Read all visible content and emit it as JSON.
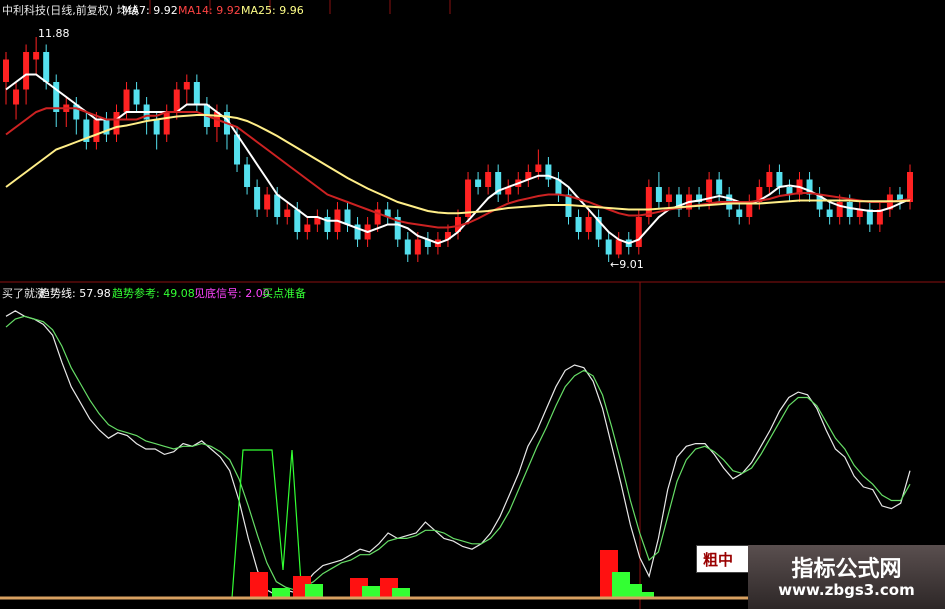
{
  "header": {
    "title": "中利科技(日线,前复权) 均线",
    "ma7": "MA7: 9.92",
    "ma14": "MA14: 9.92",
    "ma25": "MA25: 9.96"
  },
  "annotations": {
    "high": "11.88",
    "low": "←9.01"
  },
  "indicator": {
    "name": "买了就涨",
    "trend_line": "趋势线: 57.98",
    "trend_ref": "趋势参考: 49.08",
    "bottom_signal": "见底信号: 2.00",
    "buy_ready": "买点准备"
  },
  "watermark": {
    "badge": "粗中",
    "title": "指标公式网",
    "url": "www.zbgs3.com"
  },
  "colors": {
    "up": "#ff2222",
    "down": "#55e0ee",
    "ma7": "#ffffff",
    "ma14": "#cc2222",
    "ma25": "#ffee88",
    "trend": "#e8e8e8",
    "ref": "#66dd66",
    "bar_red": "#ff1111",
    "bar_green": "#33ff33",
    "grid": "#8a1010"
  },
  "chart_data": [
    {
      "type": "candlestick",
      "title": "中利科技(日线,前复权)",
      "ylim": [
        8.9,
        12.1
      ],
      "candles": [
        [
          11.3,
          11.6,
          11.7,
          11.0
        ],
        [
          11.0,
          11.2,
          11.3,
          10.8
        ],
        [
          11.2,
          11.7,
          11.8,
          11.0
        ],
        [
          11.6,
          11.7,
          11.9,
          11.4
        ],
        [
          11.7,
          11.3,
          11.8,
          11.2
        ],
        [
          11.3,
          10.9,
          11.4,
          10.7
        ],
        [
          10.9,
          11.0,
          11.1,
          10.7
        ],
        [
          11.0,
          10.8,
          11.1,
          10.6
        ],
        [
          10.8,
          10.5,
          10.9,
          10.4
        ],
        [
          10.5,
          10.8,
          10.9,
          10.4
        ],
        [
          10.8,
          10.6,
          10.9,
          10.5
        ],
        [
          10.6,
          10.9,
          11.0,
          10.5
        ],
        [
          10.9,
          11.2,
          11.3,
          10.8
        ],
        [
          11.2,
          11.0,
          11.3,
          10.9
        ],
        [
          11.0,
          10.8,
          11.1,
          10.6
        ],
        [
          10.8,
          10.6,
          10.9,
          10.4
        ],
        [
          10.6,
          10.9,
          11.0,
          10.5
        ],
        [
          10.9,
          11.2,
          11.3,
          10.8
        ],
        [
          11.2,
          11.3,
          11.4,
          11.0
        ],
        [
          11.3,
          11.0,
          11.4,
          10.9
        ],
        [
          11.0,
          10.7,
          11.1,
          10.6
        ],
        [
          10.7,
          10.9,
          11.0,
          10.5
        ],
        [
          10.9,
          10.6,
          11.0,
          10.4
        ],
        [
          10.6,
          10.2,
          10.7,
          10.1
        ],
        [
          10.2,
          9.9,
          10.3,
          9.8
        ],
        [
          9.9,
          9.6,
          10.0,
          9.5
        ],
        [
          9.6,
          9.8,
          9.9,
          9.5
        ],
        [
          9.8,
          9.5,
          9.9,
          9.4
        ],
        [
          9.5,
          9.6,
          9.7,
          9.4
        ],
        [
          9.6,
          9.3,
          9.7,
          9.2
        ],
        [
          9.3,
          9.4,
          9.5,
          9.2
        ],
        [
          9.4,
          9.5,
          9.6,
          9.3
        ],
        [
          9.5,
          9.3,
          9.6,
          9.2
        ],
        [
          9.3,
          9.6,
          9.7,
          9.2
        ],
        [
          9.6,
          9.4,
          9.7,
          9.3
        ],
        [
          9.4,
          9.2,
          9.5,
          9.1
        ],
        [
          9.2,
          9.4,
          9.5,
          9.1
        ],
        [
          9.4,
          9.6,
          9.7,
          9.3
        ],
        [
          9.6,
          9.5,
          9.7,
          9.4
        ],
        [
          9.5,
          9.2,
          9.6,
          9.1
        ],
        [
          9.2,
          9.0,
          9.3,
          8.9
        ],
        [
          9.0,
          9.2,
          9.3,
          8.9
        ],
        [
          9.2,
          9.1,
          9.3,
          9.0
        ],
        [
          9.1,
          9.2,
          9.3,
          9.0
        ],
        [
          9.2,
          9.3,
          9.4,
          9.1
        ],
        [
          9.3,
          9.5,
          9.6,
          9.2
        ],
        [
          9.5,
          10.0,
          10.1,
          9.4
        ],
        [
          10.0,
          9.9,
          10.1,
          9.8
        ],
        [
          9.9,
          10.1,
          10.2,
          9.8
        ],
        [
          10.1,
          9.8,
          10.2,
          9.7
        ],
        [
          9.8,
          9.9,
          10.0,
          9.7
        ],
        [
          9.9,
          10.0,
          10.1,
          9.8
        ],
        [
          10.0,
          10.1,
          10.2,
          9.9
        ],
        [
          10.1,
          10.2,
          10.4,
          10.0
        ],
        [
          10.2,
          10.0,
          10.3,
          9.9
        ],
        [
          10.0,
          9.8,
          10.1,
          9.7
        ],
        [
          9.8,
          9.5,
          9.9,
          9.4
        ],
        [
          9.5,
          9.3,
          9.6,
          9.2
        ],
        [
          9.3,
          9.5,
          9.6,
          9.2
        ],
        [
          9.5,
          9.2,
          9.6,
          9.1
        ],
        [
          9.2,
          9.0,
          9.3,
          8.9
        ],
        [
          9.0,
          9.2,
          9.3,
          8.95
        ],
        [
          9.2,
          9.1,
          9.3,
          9.0
        ],
        [
          9.1,
          9.5,
          9.6,
          9.0
        ],
        [
          9.5,
          9.9,
          10.0,
          9.4
        ],
        [
          9.9,
          9.7,
          10.1,
          9.6
        ],
        [
          9.7,
          9.8,
          9.9,
          9.6
        ],
        [
          9.8,
          9.6,
          9.9,
          9.5
        ],
        [
          9.6,
          9.8,
          9.9,
          9.5
        ],
        [
          9.8,
          9.7,
          9.9,
          9.6
        ],
        [
          9.7,
          10.0,
          10.1,
          9.6
        ],
        [
          10.0,
          9.8,
          10.1,
          9.7
        ],
        [
          9.8,
          9.6,
          9.9,
          9.5
        ],
        [
          9.6,
          9.5,
          9.7,
          9.4
        ],
        [
          9.5,
          9.7,
          9.8,
          9.4
        ],
        [
          9.7,
          9.9,
          10.0,
          9.6
        ],
        [
          9.9,
          10.1,
          10.2,
          9.8
        ],
        [
          10.1,
          9.9,
          10.2,
          9.8
        ],
        [
          9.9,
          9.8,
          10.0,
          9.7
        ],
        [
          9.8,
          10.0,
          10.1,
          9.7
        ],
        [
          10.0,
          9.8,
          10.1,
          9.7
        ],
        [
          9.8,
          9.6,
          9.9,
          9.5
        ],
        [
          9.6,
          9.5,
          9.7,
          9.4
        ],
        [
          9.5,
          9.7,
          9.8,
          9.4
        ],
        [
          9.7,
          9.5,
          9.8,
          9.4
        ],
        [
          9.5,
          9.6,
          9.7,
          9.4
        ],
        [
          9.6,
          9.4,
          9.7,
          9.3
        ],
        [
          9.4,
          9.6,
          9.7,
          9.3
        ],
        [
          9.6,
          9.8,
          9.9,
          9.5
        ],
        [
          9.8,
          9.7,
          9.9,
          9.6
        ],
        [
          9.7,
          10.1,
          10.2,
          9.6
        ]
      ],
      "series": [
        {
          "name": "MA7",
          "values": [
            11.2,
            11.3,
            11.4,
            11.4,
            11.3,
            11.2,
            11.1,
            11.0,
            10.9,
            10.8,
            10.8,
            10.8,
            10.9,
            10.9,
            10.9,
            10.9,
            10.9,
            10.9,
            11.0,
            11.0,
            11.0,
            10.9,
            10.8,
            10.6,
            10.4,
            10.2,
            10.0,
            9.8,
            9.7,
            9.6,
            9.5,
            9.5,
            9.45,
            9.45,
            9.4,
            9.35,
            9.3,
            9.35,
            9.4,
            9.4,
            9.35,
            9.25,
            9.2,
            9.15,
            9.2,
            9.3,
            9.45,
            9.6,
            9.75,
            9.85,
            9.9,
            9.95,
            10.0,
            10.05,
            10.05,
            10.0,
            9.9,
            9.75,
            9.6,
            9.45,
            9.3,
            9.2,
            9.15,
            9.2,
            9.35,
            9.5,
            9.6,
            9.65,
            9.7,
            9.72,
            9.75,
            9.78,
            9.75,
            9.7,
            9.68,
            9.72,
            9.8,
            9.9,
            9.92,
            9.9,
            9.85,
            9.78,
            9.7,
            9.65,
            9.62,
            9.6,
            9.58,
            9.58,
            9.62,
            9.68,
            9.74
          ]
        },
        {
          "name": "MA14",
          "values": [
            10.6,
            10.7,
            10.8,
            10.9,
            10.95,
            10.95,
            10.95,
            10.95,
            10.9,
            10.85,
            10.8,
            10.8,
            10.8,
            10.8,
            10.85,
            10.85,
            10.9,
            10.9,
            10.9,
            10.9,
            10.85,
            10.8,
            10.75,
            10.7,
            10.6,
            10.5,
            10.4,
            10.3,
            10.2,
            10.1,
            10.0,
            9.9,
            9.8,
            9.75,
            9.7,
            9.65,
            9.6,
            9.55,
            9.5,
            9.45,
            9.42,
            9.4,
            9.38,
            9.36,
            9.36,
            9.38,
            9.42,
            9.48,
            9.55,
            9.62,
            9.68,
            9.72,
            9.75,
            9.78,
            9.8,
            9.8,
            9.78,
            9.74,
            9.7,
            9.65,
            9.6,
            9.55,
            9.52,
            9.52,
            9.54,
            9.57,
            9.6,
            9.62,
            9.64,
            9.66,
            9.68,
            9.7,
            9.7,
            9.7,
            9.7,
            9.72,
            9.74,
            9.78,
            9.8,
            9.82,
            9.82,
            9.8,
            9.78,
            9.76,
            9.74,
            9.72,
            9.7,
            9.7,
            9.7,
            9.72,
            9.74
          ]
        },
        {
          "name": "MA25",
          "values": [
            9.9,
            10.0,
            10.1,
            10.2,
            10.3,
            10.4,
            10.45,
            10.5,
            10.55,
            10.6,
            10.65,
            10.7,
            10.72,
            10.75,
            10.78,
            10.8,
            10.82,
            10.84,
            10.85,
            10.86,
            10.86,
            10.85,
            10.84,
            10.82,
            10.78,
            10.72,
            10.65,
            10.58,
            10.5,
            10.42,
            10.34,
            10.26,
            10.18,
            10.1,
            10.02,
            9.95,
            9.88,
            9.82,
            9.76,
            9.7,
            9.66,
            9.62,
            9.58,
            9.56,
            9.55,
            9.55,
            9.56,
            9.57,
            9.58,
            9.6,
            9.62,
            9.63,
            9.64,
            9.65,
            9.66,
            9.66,
            9.66,
            9.65,
            9.64,
            9.63,
            9.62,
            9.61,
            9.6,
            9.6,
            9.6,
            9.61,
            9.62,
            9.63,
            9.64,
            9.65,
            9.66,
            9.67,
            9.68,
            9.68,
            9.68,
            9.68,
            9.69,
            9.7,
            9.71,
            9.72,
            9.72,
            9.72,
            9.72,
            9.72,
            9.72,
            9.71,
            9.71,
            9.71,
            9.71,
            9.71,
            9.72
          ]
        }
      ]
    },
    {
      "type": "line",
      "title": "买了就涨",
      "ylim": [
        0,
        110
      ],
      "series": [
        {
          "name": "趋势线",
          "values": [
            104,
            106,
            104,
            103,
            101,
            97,
            87,
            78,
            72,
            66,
            62,
            59,
            61,
            60,
            57,
            55,
            55,
            53,
            54,
            57,
            56,
            58,
            55,
            52,
            47,
            36,
            22,
            10,
            3,
            1,
            3,
            2,
            5,
            9,
            12,
            13,
            14,
            16,
            18,
            17,
            20,
            24,
            22,
            23,
            24,
            28,
            25,
            22,
            21,
            19,
            18,
            20,
            24,
            30,
            38,
            46,
            56,
            62,
            70,
            78,
            84,
            86,
            85,
            80,
            70,
            56,
            42,
            27,
            15,
            8,
            22,
            40,
            52,
            56,
            57,
            57,
            53,
            48,
            44,
            46,
            50,
            56,
            62,
            69,
            74,
            76,
            75,
            70,
            62,
            55,
            52,
            45,
            41,
            40,
            34,
            33,
            35,
            47
          ]
        },
        {
          "name": "趋势参考",
          "values": [
            100,
            103,
            104,
            103,
            102,
            99,
            93,
            85,
            79,
            73,
            68,
            64,
            62,
            61,
            60,
            58,
            57,
            56,
            55,
            56,
            56,
            57,
            56,
            54,
            51,
            44,
            34,
            23,
            13,
            6,
            4,
            3,
            4,
            6,
            9,
            11,
            13,
            14,
            16,
            16,
            18,
            21,
            22,
            22,
            23,
            25,
            25,
            24,
            22,
            21,
            20,
            20,
            22,
            26,
            32,
            40,
            48,
            56,
            63,
            71,
            78,
            82,
            84,
            82,
            75,
            63,
            50,
            36,
            24,
            14,
            17,
            30,
            43,
            51,
            55,
            56,
            54,
            51,
            47,
            46,
            48,
            53,
            59,
            65,
            71,
            74,
            74,
            71,
            65,
            59,
            55,
            49,
            45,
            42,
            38,
            36,
            36,
            42
          ]
        }
      ],
      "bottom_signal_bars": [
        {
          "color": "red",
          "values": [
            [
              240,
              18
            ],
            [
              262,
              12
            ]
          ]
        },
        {
          "color": "green",
          "values": [
            [
              250,
              10
            ],
            [
              280,
              6
            ]
          ]
        }
      ]
    }
  ]
}
